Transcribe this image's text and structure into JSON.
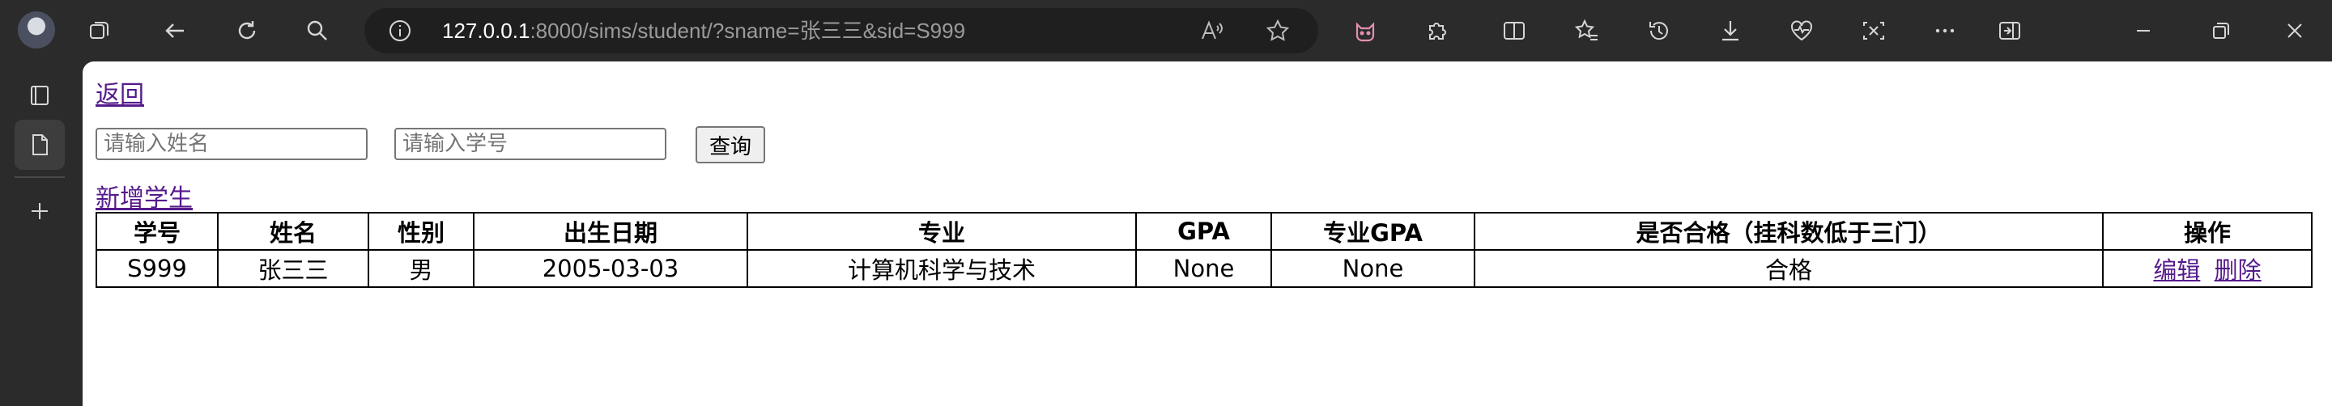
{
  "browser": {
    "url_host": "127.0.0.1",
    "url_rest": ":8000/sims/student/?sname=张三三&sid=S999"
  },
  "page": {
    "back_link": "返回",
    "name_placeholder": "请输入姓名",
    "id_placeholder": "请输入学号",
    "search_button": "查询",
    "add_link": "新增学生"
  },
  "table": {
    "headers": [
      "学号",
      "姓名",
      "性别",
      "出生日期",
      "专业",
      "GPA",
      "专业GPA",
      "是否合格（挂科数低于三门）",
      "操作"
    ],
    "rows": [
      {
        "sid": "S999",
        "name": "张三三",
        "gender": "男",
        "birth": "2005-03-03",
        "major": "计算机科学与技术",
        "gpa": "None",
        "major_gpa": "None",
        "qualified": "合格",
        "edit": "编辑",
        "delete": "删除"
      }
    ]
  },
  "icons": {
    "topbar": [
      "avatar",
      "workspaces-icon",
      "back-arrow-icon",
      "refresh-icon",
      "search-icon",
      "info-icon",
      "read-aloud-icon",
      "favorite-star-icon",
      "extension-cat-icon",
      "puzzle-extensions-icon",
      "split-screen-icon",
      "favorites-icon",
      "history-icon",
      "download-icon",
      "health-heart-icon",
      "screenshot-icon",
      "more-icon",
      "sidebar-icon",
      "minimize-icon",
      "restore-icon",
      "close-icon"
    ],
    "sidebar": [
      "tab-icon",
      "page-icon",
      "new-tab-plus-icon"
    ]
  }
}
